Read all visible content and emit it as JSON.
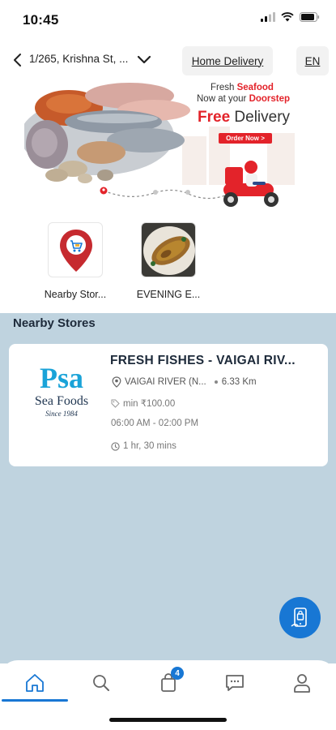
{
  "status_bar": {
    "time": "10:45"
  },
  "header": {
    "address": "1/265, Krishna St, ...",
    "delivery_mode": "Home Delivery",
    "language": "EN"
  },
  "banner": {
    "line1_prefix": "Fresh ",
    "line1_highlight": "Seafood",
    "line2_prefix": "Now at your ",
    "line2_highlight": "Doorstep",
    "free_highlight": "Free",
    "free_rest": " Delivery",
    "cta": "Order Now >"
  },
  "categories": [
    {
      "label": "Nearby Stor...",
      "icon": "store-location-pin-icon"
    },
    {
      "label": "EVENING E...",
      "icon": "fried-fish-photo"
    }
  ],
  "stores_section": {
    "title": "Nearby Stores",
    "stores": [
      {
        "logo_brand": "Psa",
        "logo_sub": "Sea Foods",
        "logo_since": "Since 1984",
        "name": "FRESH FISHES - VAIGAI RIV...",
        "location": "VAIGAI RIVER (N...",
        "distance": "6.33 Km",
        "min_order": "min ₹100.00",
        "hours": "06:00 AM - 02:00 PM",
        "delivery_time": "1 hr, 30 mins"
      }
    ]
  },
  "bottom_nav": {
    "items": [
      "home",
      "search",
      "cart",
      "messages",
      "profile"
    ],
    "cart_count": "4",
    "active": "home"
  },
  "colors": {
    "accent": "#1877d4",
    "section_bg": "#bfd3df",
    "promo_red": "#e3232a"
  }
}
